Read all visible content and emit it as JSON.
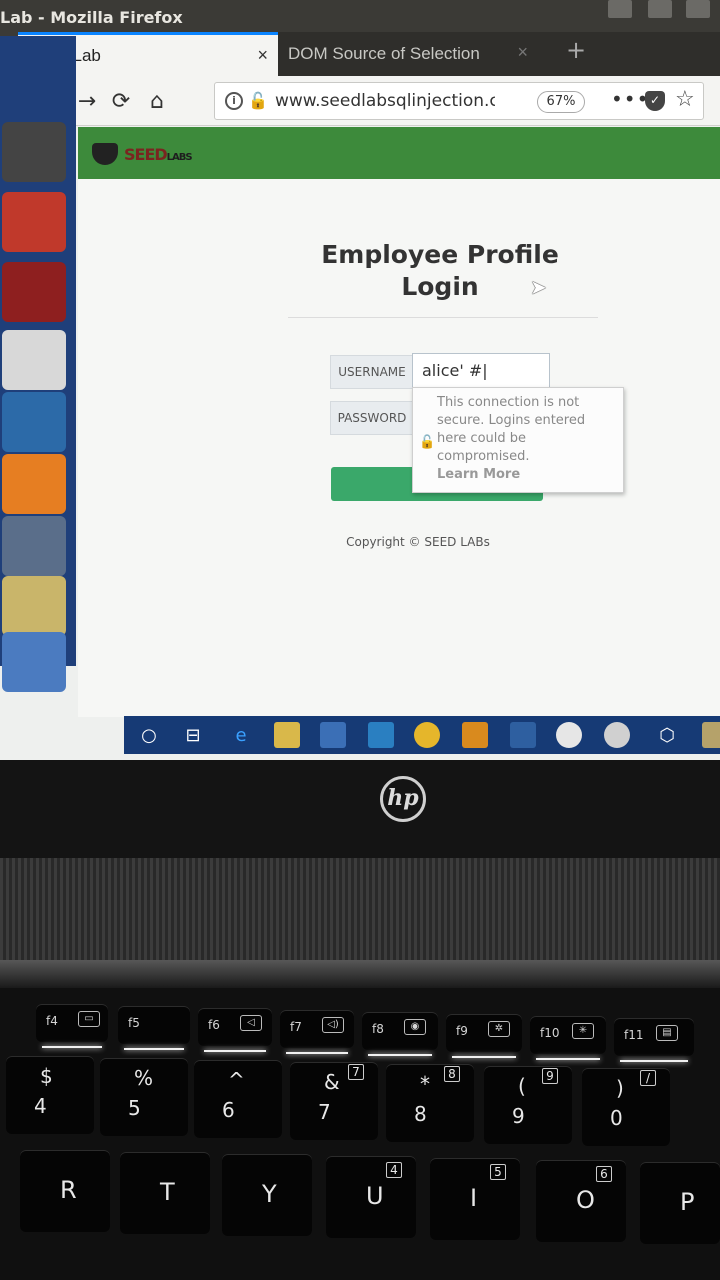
{
  "window": {
    "title": "Lab - Mozilla Firefox"
  },
  "tabs": [
    {
      "label": "SQLi Lab",
      "close": "×"
    },
    {
      "label": "DOM Source of Selection",
      "close": "×"
    }
  ],
  "new_tab": "+",
  "nav": {
    "back": "←",
    "forward": "→",
    "reload": "⟳",
    "home": "⌂"
  },
  "urlbar": {
    "info": "i",
    "lock": "🔓",
    "url": "www.seedlabsqlinjection.c",
    "zoom": "67%",
    "more": "•••",
    "pocket": "✓",
    "bookmark": "☆"
  },
  "page": {
    "logo_text": {
      "seed": "SEED",
      "labs": "LABS"
    },
    "title_line1": "Employee Profile",
    "title_line2": "Login",
    "username_label": "USERNAME",
    "username_value": "alice' #|",
    "password_label": "PASSWORD",
    "tooltip_text": "This connection is not secure. Logins entered here could be compromised.",
    "tooltip_link": "Learn More",
    "copyright": "Copyright © SEED LABs"
  },
  "keyboard": {
    "fkeys": [
      "f4",
      "f5",
      "f6",
      "f7",
      "f8",
      "f9",
      "f10",
      "f11"
    ],
    "number_row": [
      {
        "top": "$",
        "bot": "4"
      },
      {
        "top": "%",
        "bot": "5"
      },
      {
        "top": "^",
        "bot": "6"
      },
      {
        "top": "&",
        "bot": "7",
        "pad": "7"
      },
      {
        "top": "*",
        "bot": "8",
        "pad": "8"
      },
      {
        "top": "(",
        "bot": "9",
        "pad": "9"
      },
      {
        "top": ")",
        "bot": "0",
        "pad": "/"
      }
    ],
    "letter_row": [
      {
        "key": "R"
      },
      {
        "key": "T"
      },
      {
        "key": "Y"
      },
      {
        "key": "U",
        "pad": "4"
      },
      {
        "key": "I",
        "pad": "5"
      },
      {
        "key": "O",
        "pad": "6"
      },
      {
        "key": "P"
      }
    ]
  },
  "brand": "hp",
  "colors": {
    "banner": "#3d8a3b",
    "login_button": "#3aa86a",
    "launcher": "#1f3f7a",
    "taskbar": "#163a75"
  }
}
